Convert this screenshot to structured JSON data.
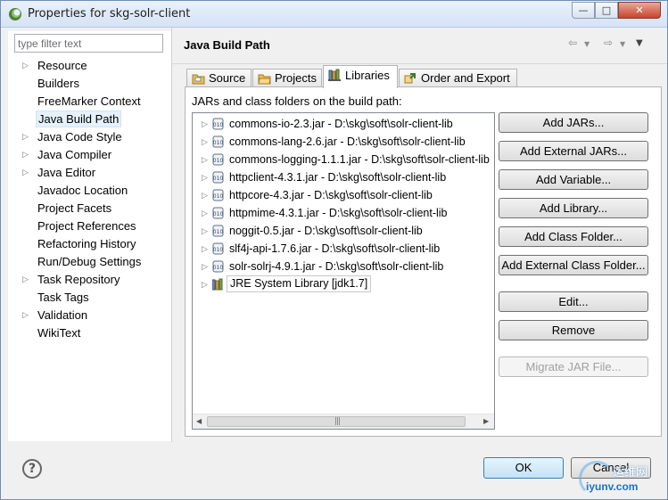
{
  "window": {
    "title": "Properties for skg-solr-client",
    "min": "—",
    "max": "□",
    "close": "✕"
  },
  "filter": {
    "placeholder": "type filter text"
  },
  "sidebar": {
    "items": [
      {
        "label": "Resource",
        "expandable": true
      },
      {
        "label": "Builders",
        "expandable": false
      },
      {
        "label": "FreeMarker Context",
        "expandable": false
      },
      {
        "label": "Java Build Path",
        "expandable": false,
        "selected": true
      },
      {
        "label": "Java Code Style",
        "expandable": true
      },
      {
        "label": "Java Compiler",
        "expandable": true
      },
      {
        "label": "Java Editor",
        "expandable": true
      },
      {
        "label": "Javadoc Location",
        "expandable": false
      },
      {
        "label": "Project Facets",
        "expandable": false
      },
      {
        "label": "Project References",
        "expandable": false
      },
      {
        "label": "Refactoring History",
        "expandable": false
      },
      {
        "label": "Run/Debug Settings",
        "expandable": false
      },
      {
        "label": "Task Repository",
        "expandable": true
      },
      {
        "label": "Task Tags",
        "expandable": false
      },
      {
        "label": "Validation",
        "expandable": true
      },
      {
        "label": "WikiText",
        "expandable": false
      }
    ]
  },
  "page": {
    "title": "Java Build Path"
  },
  "tabs": [
    {
      "label": "Source",
      "icon": "source-folder-icon"
    },
    {
      "label": "Projects",
      "icon": "projects-folder-icon"
    },
    {
      "label": "Libraries",
      "icon": "libraries-icon",
      "active": true
    },
    {
      "label": "Order and Export",
      "icon": "order-export-icon"
    }
  ],
  "libraries": {
    "label": "JARs and class folders on the build path:",
    "entries": [
      {
        "text": "commons-io-2.3.jar - D:\\skg\\soft\\solr-client-lib"
      },
      {
        "text": "commons-lang-2.6.jar - D:\\skg\\soft\\solr-client-lib"
      },
      {
        "text": "commons-logging-1.1.1.jar - D:\\skg\\soft\\solr-client-lib"
      },
      {
        "text": "httpclient-4.3.1.jar - D:\\skg\\soft\\solr-client-lib"
      },
      {
        "text": "httpcore-4.3.jar - D:\\skg\\soft\\solr-client-lib"
      },
      {
        "text": "httpmime-4.3.1.jar - D:\\skg\\soft\\solr-client-lib"
      },
      {
        "text": "noggit-0.5.jar - D:\\skg\\soft\\solr-client-lib"
      },
      {
        "text": "slf4j-api-1.7.6.jar - D:\\skg\\soft\\solr-client-lib"
      },
      {
        "text": "solr-solrj-4.9.1.jar - D:\\skg\\soft\\solr-client-lib"
      },
      {
        "text": "JRE System Library [jdk1.7]",
        "jre": true
      }
    ],
    "buttons": [
      {
        "label": "Add JARs...",
        "name": "add-jars-button"
      },
      {
        "label": "Add External JARs...",
        "name": "add-external-jars-button"
      },
      {
        "label": "Add Variable...",
        "name": "add-variable-button"
      },
      {
        "label": "Add Library...",
        "name": "add-library-button"
      },
      {
        "label": "Add Class Folder...",
        "name": "add-class-folder-button"
      },
      {
        "label": "Add External Class Folder...",
        "name": "add-external-class-folder-button"
      },
      {
        "label": "Edit...",
        "name": "edit-button"
      },
      {
        "label": "Remove",
        "name": "remove-button"
      },
      {
        "label": "Migrate JAR File...",
        "name": "migrate-jar-button",
        "disabled": true
      }
    ]
  },
  "footer": {
    "help": "?",
    "ok": "OK",
    "cancel": "Cancel"
  },
  "watermark": {
    "line1": "运维网",
    "line2": "iyunv.com"
  }
}
